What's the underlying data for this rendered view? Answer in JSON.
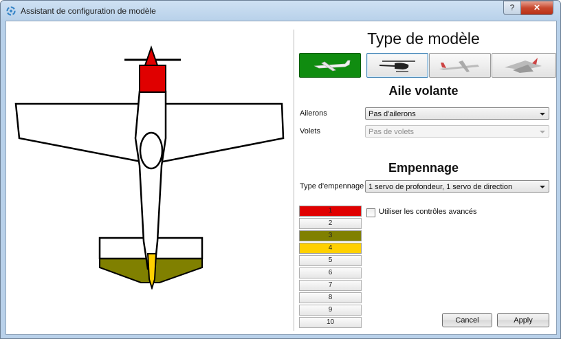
{
  "window": {
    "title": "Assistant de configuration de modèle",
    "help_label": "?",
    "close_label": "✕"
  },
  "model_type": {
    "heading": "Type de modèle",
    "types": [
      {
        "name": "airplane",
        "selected": true
      },
      {
        "name": "helicopter",
        "selected": false
      },
      {
        "name": "glider",
        "selected": false
      },
      {
        "name": "delta-wing",
        "selected": false
      }
    ]
  },
  "wing": {
    "heading": "Aile volante",
    "ailerons_label": "Ailerons",
    "ailerons_value": "Pas d'ailerons",
    "flaps_label": "Volets",
    "flaps_value": "Pas de volets"
  },
  "tail": {
    "heading": "Empennage",
    "type_label": "Type d'empennage",
    "type_value": "1 servo de profondeur, 1 servo de direction"
  },
  "channels": [
    {
      "label": "1",
      "color": "#e00000"
    },
    {
      "label": "2",
      "color": null
    },
    {
      "label": "3",
      "color": "#808000"
    },
    {
      "label": "4",
      "color": "#ffd000"
    },
    {
      "label": "5",
      "color": null
    },
    {
      "label": "6",
      "color": null
    },
    {
      "label": "7",
      "color": null
    },
    {
      "label": "8",
      "color": null
    },
    {
      "label": "9",
      "color": null
    },
    {
      "label": "10",
      "color": null
    }
  ],
  "advanced": {
    "label": "Utiliser les contrôles avancés",
    "checked": false
  },
  "buttons": {
    "cancel": "Cancel",
    "apply": "Apply"
  },
  "colors": {
    "selected_type": "#108c10",
    "engine": "#e00000",
    "elevator": "#808000",
    "rudder": "#ffd000"
  }
}
